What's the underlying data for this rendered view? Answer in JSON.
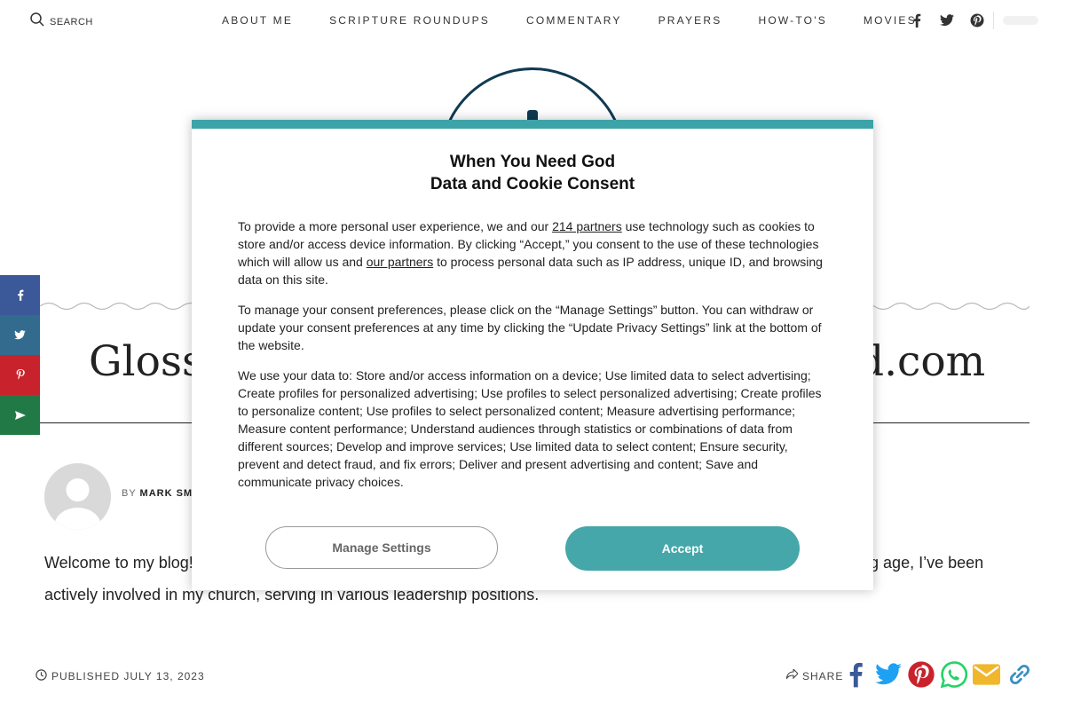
{
  "topbar": {
    "search_label": "SEARCH",
    "nav": [
      "ABOUT ME",
      "SCRIPTURE ROUNDUPS",
      "COMMENTARY",
      "PRAYERS",
      "HOW-TO'S",
      "MOVIES"
    ]
  },
  "article": {
    "title_left": "Gloss",
    "title_right": "d.com",
    "byline_prefix": "BY",
    "author": "MARK SM",
    "body_left": "Welcome to my blog!",
    "body_right": "oung age, I’ve been",
    "body_line2": "actively involved in my church, serving in various leadership positions.",
    "published": "PUBLISHED JULY 13, 2023",
    "share_label": "SHARE"
  },
  "consent": {
    "title_line1": "When You Need God",
    "title_line2": "Data and Cookie Consent",
    "p1_a": "To provide a more personal user experience, we and our ",
    "p1_link1": "214 partners",
    "p1_b": " use technology such as cookies to store and/or access device information. By clicking “Accept,” you consent to the use of these technologies which will allow us and ",
    "p1_link2": "our partners",
    "p1_c": " to process personal data such as IP address, unique ID, and browsing data on this site.",
    "p2": "To manage your consent preferences, please click on the “Manage Settings” button. You can withdraw or update your consent preferences at any time by clicking the “Update Privacy Settings” link at the bottom of the website.",
    "p3": "We use your data to: Store and/or access information on a device; Use limited data to select advertising; Create profiles for personalized advertising; Use profiles to select personalized advertising; Create profiles to personalize content; Use profiles to select personalized content; Measure advertising performance; Measure content performance; Understand audiences through statistics or combinations of data from different sources; Develop and improve services; Use limited data to select content; Ensure security, prevent and detect fraud, and fix errors; Deliver and present advertising and content; Save and communicate privacy choices.",
    "manage_label": "Manage Settings",
    "accept_label": "Accept"
  },
  "colors": {
    "accent": "#3ca4a8",
    "facebook": "#3b5998",
    "twitter": "#1da1f2",
    "pinterest": "#c8232c",
    "whatsapp": "#25d366",
    "email": "#f0b62c",
    "side_facebook": "#3b5998",
    "side_twitter": "#336b8f",
    "side_pinterest": "#c8232c",
    "side_email": "#217a45"
  }
}
